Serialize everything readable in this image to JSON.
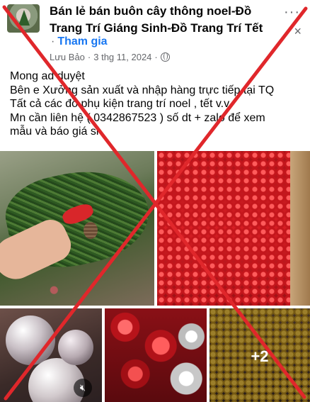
{
  "post": {
    "group_name": "Bán lẻ bán buôn cây thông noel-Đồ Trang Trí Giáng Sinh-Đồ Trang Trí Tết",
    "join_label": "Tham gia",
    "author": "Lưu Bảo",
    "date": "3 thg 11, 2024",
    "more_label": "···",
    "close_label": "×",
    "text_lines": [
      "Mong ad duyệt",
      "Bên e Xưởng sản xuất và nhập hàng trực tiếp tại TQ",
      "Tất cả các đồ phụ kiện trang trí noel , tết v.v",
      "Mn cần liên hệ ( 0342867523 ) số dt + zalo để xem",
      "mẫu và báo giá sỉ"
    ]
  },
  "media": {
    "more_count": "+2",
    "mute_icon": "speaker-muted-icon"
  },
  "colors": {
    "link_blue": "#1877f2",
    "meta_gray": "#65676b",
    "cross_red": "#e0272b"
  }
}
